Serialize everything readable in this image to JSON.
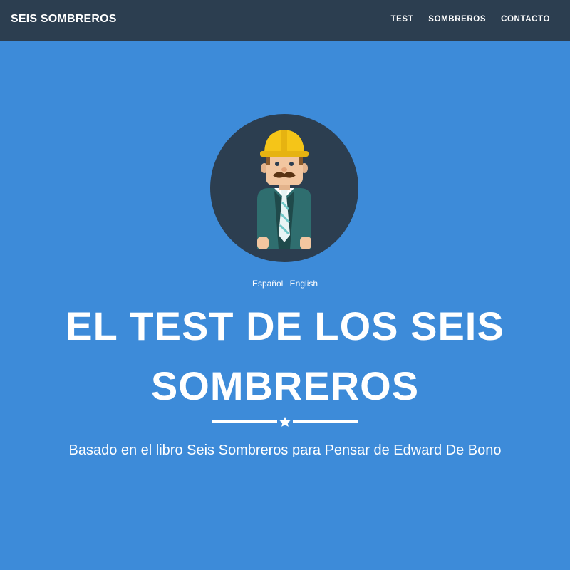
{
  "navbar": {
    "brand": "SEIS SOMBREROS",
    "links": [
      "TEST",
      "SOMBREROS",
      "CONTACTO"
    ],
    "bg_color": "#2c3e50"
  },
  "hero": {
    "bg_color": "#3d8bd9",
    "avatar_icon": "construction-worker-avatar",
    "languages": [
      "Español",
      "English"
    ],
    "title_line1": "EL TEST DE LOS SEIS",
    "title_line2": "SOMBREROS",
    "divider_icon": "star-icon",
    "subtitle": "Basado en el libro Seis Sombreros para Pensar de Edward De Bono"
  }
}
